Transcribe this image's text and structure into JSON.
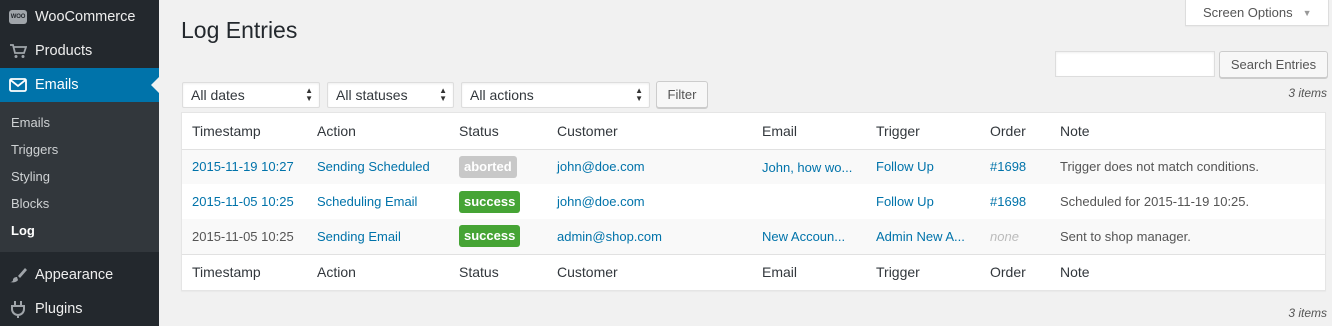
{
  "sidebar": {
    "menu_top": [
      {
        "label": "WooCommerce",
        "icon": "woo-icon",
        "icon_text": "WOO"
      },
      {
        "label": "Products",
        "icon": "cart-icon"
      },
      {
        "label": "Emails",
        "icon": "envelope-icon",
        "current": true
      }
    ],
    "submenu": [
      {
        "label": "Emails"
      },
      {
        "label": "Triggers"
      },
      {
        "label": "Styling"
      },
      {
        "label": "Blocks"
      },
      {
        "label": "Log",
        "active": true
      }
    ],
    "menu_bottom": [
      {
        "label": "Appearance",
        "icon": "paintbrush-icon"
      },
      {
        "label": "Plugins",
        "icon": "plugin-icon"
      }
    ],
    "colors": {
      "bg": "#23282d",
      "current": "#0073aa"
    }
  },
  "header": {
    "screen_options": "Screen Options",
    "title": "Log Entries"
  },
  "search": {
    "value": "",
    "placeholder": "",
    "button": "Search Entries"
  },
  "filters": {
    "dates": "All dates",
    "statuses": "All statuses",
    "actions": "All actions",
    "button": "Filter"
  },
  "items_count": "3 items",
  "table": {
    "columns": [
      "Timestamp",
      "Action",
      "Status",
      "Customer",
      "Email",
      "Trigger",
      "Order",
      "Note"
    ],
    "rows": [
      {
        "timestamp": "2015-11-19 10:27",
        "timestamp_link": true,
        "action": "Sending Scheduled",
        "status": "aborted",
        "customer": "john@doe.com",
        "email": "John, how wo...",
        "trigger": "Follow Up",
        "order": "#1698",
        "note": "Trigger does not match conditions."
      },
      {
        "timestamp": "2015-11-05 10:25",
        "timestamp_link": true,
        "action": "Scheduling Email",
        "status": "success",
        "customer": "john@doe.com",
        "email": "",
        "trigger": "Follow Up",
        "order": "#1698",
        "note": "Scheduled for 2015-11-19 10:25."
      },
      {
        "timestamp": "2015-11-05 10:25",
        "timestamp_link": false,
        "action": "Sending Email",
        "status": "success",
        "customer": "admin@shop.com",
        "email": "New Accoun...",
        "trigger": "Admin New A...",
        "order": "none",
        "note": "Sent to shop manager."
      }
    ]
  },
  "colors": {
    "link": "#0073aa",
    "success": "#46a435",
    "aborted": "#c8c8c8"
  }
}
